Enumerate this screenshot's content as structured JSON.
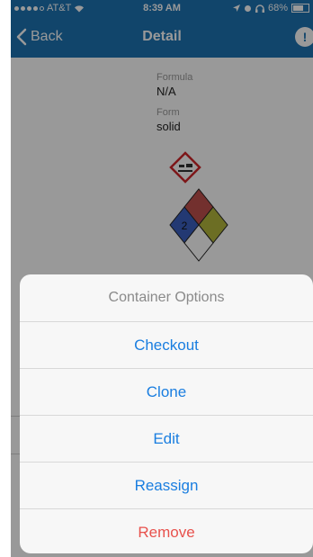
{
  "status_bar": {
    "carrier": "AT&T",
    "time": "8:39 AM",
    "battery": "68%",
    "battery_level": 0.68
  },
  "nav": {
    "back_label": "Back",
    "title": "Detail",
    "info_label": "!"
  },
  "detail": {
    "clipped_value": "",
    "fields": [
      {
        "label": "Formula",
        "value": "N/A"
      },
      {
        "label": "Form",
        "value": "solid"
      }
    ],
    "nfpa": {
      "health": "",
      "flammability": "",
      "reactivity": "2",
      "special": ""
    }
  },
  "action_sheet": {
    "title": "Container Options",
    "buttons": [
      {
        "label": "Checkout"
      },
      {
        "label": "Clone"
      },
      {
        "label": "Edit"
      },
      {
        "label": "Reassign"
      },
      {
        "label": "Remove",
        "style": "destructive"
      }
    ]
  },
  "colors": {
    "nav_background": "#1d73b3",
    "action_tint": "#1a7ee0",
    "destructive": "#e8524d",
    "nfpa_health": "#3b5fc0",
    "nfpa_flammability": "#c0504d",
    "nfpa_reactivity": "#b5b83c",
    "nfpa_special": "#ffffff"
  },
  "icons": {
    "back": "chevron-left-icon",
    "wifi": "wifi-icon",
    "location": "location-arrow-icon",
    "alarm": "alarm-icon",
    "headphones": "headphones-icon",
    "ghs": "ghs-corrosive-pictogram"
  }
}
